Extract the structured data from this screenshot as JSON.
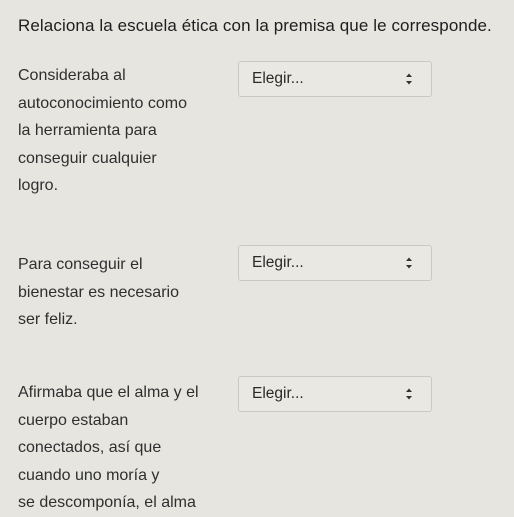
{
  "question": {
    "title": "Relaciona la escuela ética con la premisa que le corresponde."
  },
  "items": [
    {
      "premise_lines": [
        "Consideraba al",
        "autoconocimiento como",
        "la herramienta para",
        "conseguir cualquier",
        "logro."
      ],
      "select_value": "Elegir..."
    },
    {
      "premise_lines": [
        "Para conseguir el",
        "bienestar es necesario",
        "ser feliz."
      ],
      "select_value": "Elegir..."
    },
    {
      "premise_lines": [
        "Afirmaba que el alma y el",
        "cuerpo estaban",
        "conectados, así que",
        "cuando uno moría y",
        "se descomponía, el alma"
      ],
      "select_value": "Elegir..."
    }
  ],
  "icons": {
    "select_arrow": "up-down-chevron-icon"
  }
}
